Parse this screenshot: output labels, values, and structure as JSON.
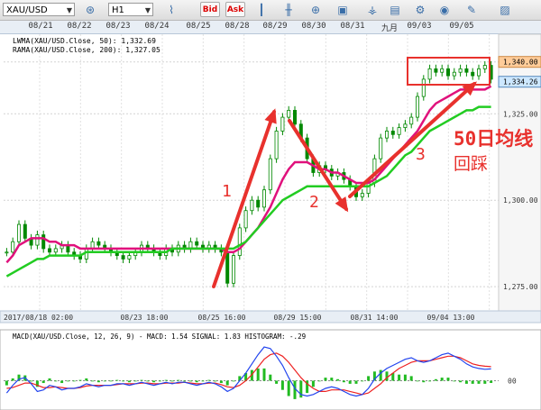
{
  "toolbar": {
    "symbol": "XAU/USD",
    "timeframe": "H1",
    "bid_label": "Bid",
    "ask_label": "Ask",
    "icons": [
      "crosshair-icon",
      "line-chart-icon",
      "bar-chart-icon",
      "candle-icon",
      "zoom-icon",
      "indicator-icon",
      "draw-icon",
      "save-icon",
      "settings-icon",
      "pencil-icon",
      "screenshot-icon"
    ]
  },
  "top_dates": [
    "08/21",
    "08/22",
    "08/23",
    "08/24",
    "08/25",
    "08/28",
    "08/29",
    "08/30",
    "08/31",
    "九月",
    "09/03",
    "09/05"
  ],
  "legend": {
    "lwma": "LWMA(XAU/USD.Close, 50): 1,332.69",
    "rama": "RAMA(XAU/USD.Close, 200): 1,327.05"
  },
  "colors": {
    "lwma": "#e0117c",
    "rama": "#22cc22",
    "candle": "#008800",
    "annotation": "#e8312d",
    "price_box": "#e8312d",
    "macd_line": "#2244ee",
    "signal_line": "#ee2222",
    "histogram": "#22bb22"
  },
  "annotations": {
    "wave1": "1",
    "wave2": "2",
    "wave3": "3",
    "note_line1": "50日均线",
    "note_line2": "回踩"
  },
  "macd_legend": "MACD(XAU/USD.Close, 12, 26, 9) - MACD: 1.54 SIGNAL: 1.83 HISTOGRAM: -.29",
  "bottom_labels": [
    "2017/08/18 02:00",
    "08/23 18:00",
    "08/25 16:00",
    "08/29 15:00",
    "08/31 14:00",
    "09/04 13:00"
  ],
  "chart_data": {
    "type": "line",
    "title": "",
    "xlabel": "",
    "ylabel": "",
    "y_ticks": [
      1275,
      1300,
      1325,
      1340
    ],
    "y_tick_labels": [
      "1,275.00",
      "1,300.00",
      "1,325.00",
      "1,340.00"
    ],
    "ylim": [
      1268,
      1348
    ],
    "current_prices": {
      "top": "1,340.00",
      "current": "1,334.26"
    },
    "x_labels": [
      "08/21",
      "08/22",
      "08/23",
      "08/24",
      "08/25",
      "08/28",
      "08/29",
      "08/30",
      "08/31",
      "九月",
      "09/03",
      "09/05"
    ],
    "series": [
      {
        "name": "XAU/USD",
        "values": [
          1285,
          1288,
          1293,
          1289,
          1287,
          1290,
          1286,
          1285,
          1286,
          1287,
          1285,
          1284,
          1283,
          1286,
          1288,
          1287,
          1286,
          1285,
          1284,
          1283,
          1284,
          1285,
          1287,
          1286,
          1285,
          1284,
          1286,
          1285,
          1287,
          1286,
          1288,
          1287,
          1286,
          1287,
          1286,
          1285,
          1276,
          1284,
          1292,
          1297,
          1300,
          1298,
          1303,
          1312,
          1320,
          1324,
          1326,
          1322,
          1318,
          1312,
          1308,
          1310,
          1309,
          1307,
          1308,
          1306,
          1304,
          1301,
          1302,
          1305,
          1312,
          1318,
          1320,
          1319,
          1321,
          1322,
          1324,
          1330,
          1335,
          1338,
          1337,
          1338,
          1336,
          1337,
          1338,
          1337,
          1336,
          1338,
          1339,
          1335
        ]
      },
      {
        "name": "LWMA(XAU/USD.Close, 50)",
        "values": [
          1282,
          1284,
          1287,
          1288,
          1289,
          1289,
          1289,
          1288,
          1288,
          1287,
          1287,
          1287,
          1286,
          1286,
          1286,
          1286,
          1286,
          1286,
          1286,
          1286,
          1286,
          1286,
          1286,
          1286,
          1286,
          1286,
          1286,
          1286,
          1286,
          1286,
          1286,
          1286,
          1286,
          1286,
          1286,
          1286,
          1285,
          1285,
          1286,
          1288,
          1290,
          1292,
          1295,
          1298,
          1302,
          1306,
          1309,
          1311,
          1311,
          1311,
          1310,
          1309,
          1309,
          1308,
          1308,
          1307,
          1306,
          1305,
          1305,
          1305,
          1306,
          1308,
          1310,
          1312,
          1314,
          1316,
          1318,
          1320,
          1323,
          1326,
          1328,
          1329,
          1330,
          1331,
          1332,
          1332,
          1332,
          1332,
          1332,
          1333
        ]
      },
      {
        "name": "RAMA(XAU/USD.Close, 200)",
        "values": [
          1278,
          1279,
          1280,
          1281,
          1282,
          1283,
          1283,
          1284,
          1284,
          1284,
          1284,
          1284,
          1284,
          1285,
          1285,
          1285,
          1285,
          1285,
          1285,
          1285,
          1285,
          1285,
          1285,
          1285,
          1285,
          1285,
          1285,
          1286,
          1286,
          1286,
          1286,
          1286,
          1286,
          1286,
          1286,
          1286,
          1286,
          1286,
          1287,
          1288,
          1290,
          1292,
          1294,
          1296,
          1298,
          1300,
          1301,
          1302,
          1303,
          1304,
          1304,
          1304,
          1304,
          1304,
          1304,
          1304,
          1304,
          1304,
          1304,
          1304,
          1305,
          1306,
          1307,
          1309,
          1311,
          1313,
          1314,
          1316,
          1318,
          1320,
          1321,
          1322,
          1323,
          1324,
          1325,
          1326,
          1326,
          1327,
          1327,
          1327
        ]
      }
    ],
    "macd": {
      "macd": [
        -1.6,
        -0.6,
        0.2,
        0.4,
        -0.4,
        -1.4,
        -1.2,
        -0.6,
        -0.8,
        -1.2,
        -1.0,
        -1.0,
        -0.8,
        -0.4,
        -0.6,
        -0.8,
        -0.6,
        -0.6,
        -0.4,
        -0.4,
        -0.6,
        -0.4,
        -0.2,
        -0.4,
        -0.6,
        -0.4,
        -0.2,
        -0.4,
        -0.2,
        -0.2,
        -0.4,
        -0.6,
        -0.4,
        -0.2,
        -0.4,
        -0.8,
        -1.4,
        -1.0,
        0.0,
        1.0,
        2.2,
        3.4,
        4.4,
        4.2,
        3.2,
        2.0,
        0.4,
        -1.0,
        -1.8,
        -2.0,
        -1.8,
        -1.4,
        -1.0,
        -0.8,
        -1.0,
        -1.4,
        -1.8,
        -2.0,
        -1.8,
        -1.0,
        0.2,
        1.0,
        1.6,
        2.0,
        2.4,
        2.8,
        3.0,
        2.6,
        2.4,
        2.6,
        3.0,
        3.4,
        3.6,
        3.2,
        2.8,
        2.2,
        1.8,
        1.6,
        1.5,
        1.54
      ],
      "signal": [
        -1.0,
        -0.9,
        -0.6,
        -0.3,
        -0.3,
        -0.6,
        -0.9,
        -0.9,
        -0.8,
        -0.9,
        -1.0,
        -1.0,
        -0.9,
        -0.7,
        -0.6,
        -0.6,
        -0.6,
        -0.6,
        -0.5,
        -0.4,
        -0.4,
        -0.4,
        -0.3,
        -0.3,
        -0.4,
        -0.4,
        -0.3,
        -0.3,
        -0.3,
        -0.2,
        -0.3,
        -0.4,
        -0.4,
        -0.3,
        -0.3,
        -0.5,
        -0.8,
        -0.9,
        -0.6,
        0.0,
        0.8,
        1.8,
        2.8,
        3.4,
        3.6,
        3.2,
        2.4,
        1.4,
        0.4,
        -0.4,
        -1.0,
        -1.4,
        -1.4,
        -1.2,
        -1.2,
        -1.2,
        -1.4,
        -1.6,
        -1.8,
        -1.6,
        -1.0,
        -0.4,
        0.4,
        1.0,
        1.6,
        2.0,
        2.4,
        2.6,
        2.6,
        2.6,
        2.8,
        3.0,
        3.2,
        3.2,
        3.0,
        2.6,
        2.2,
        2.0,
        1.9,
        1.83
      ],
      "histogram": [
        -0.6,
        0.3,
        0.8,
        0.7,
        -0.1,
        -0.8,
        -0.3,
        0.3,
        0.0,
        -0.3,
        0.0,
        0.0,
        0.1,
        0.3,
        0.0,
        -0.2,
        0.0,
        0.0,
        0.1,
        0.0,
        -0.2,
        0.0,
        0.1,
        -0.1,
        -0.2,
        0.0,
        0.1,
        -0.1,
        0.1,
        0.0,
        -0.1,
        -0.2,
        0.0,
        0.1,
        -0.1,
        -0.3,
        -0.6,
        -0.1,
        0.6,
        1.0,
        1.4,
        1.6,
        1.6,
        0.8,
        -0.4,
        -1.2,
        -2.0,
        -2.4,
        -2.2,
        -1.6,
        -0.8,
        0.0,
        0.4,
        0.4,
        0.2,
        -0.2,
        -0.4,
        -0.4,
        0.0,
        0.6,
        1.2,
        1.4,
        1.2,
        1.0,
        0.8,
        0.8,
        0.6,
        0.0,
        -0.2,
        0.0,
        0.2,
        0.4,
        0.4,
        0.0,
        -0.2,
        -0.4,
        -0.4,
        -0.4,
        -0.4,
        -0.29
      ],
      "zero_label": "00"
    }
  }
}
